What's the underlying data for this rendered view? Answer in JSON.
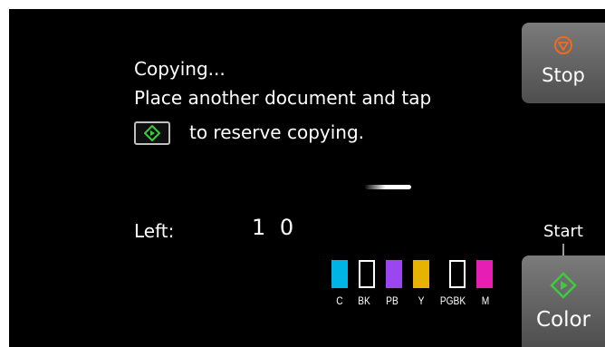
{
  "message": {
    "line1": "Copying...",
    "line2": "Place another document and tap",
    "line3": "to reserve copying.",
    "inline_icon": "start-diamond-icon"
  },
  "progress": {
    "state": "in-progress"
  },
  "copies": {
    "label": "Left:",
    "value": "1 0"
  },
  "ink_tanks": [
    {
      "label": "C",
      "color": "#00b4e6",
      "filled": true
    },
    {
      "label": "BK",
      "color": "#000000",
      "filled": false
    },
    {
      "label": "PB",
      "color": "#9b46f0",
      "filled": true
    },
    {
      "label": "Y",
      "color": "#e6b400",
      "filled": true
    },
    {
      "label": "PGBK",
      "color": "#000000",
      "filled": false
    },
    {
      "label": "M",
      "color": "#e61eb4",
      "filled": true
    }
  ],
  "buttons": {
    "stop": {
      "label": "Stop",
      "icon": "stop-icon",
      "icon_color": "#f06a1e"
    },
    "start_caption": "Start",
    "color": {
      "label": "Color",
      "icon": "start-diamond-icon",
      "icon_color": "#3ccc3c"
    }
  }
}
